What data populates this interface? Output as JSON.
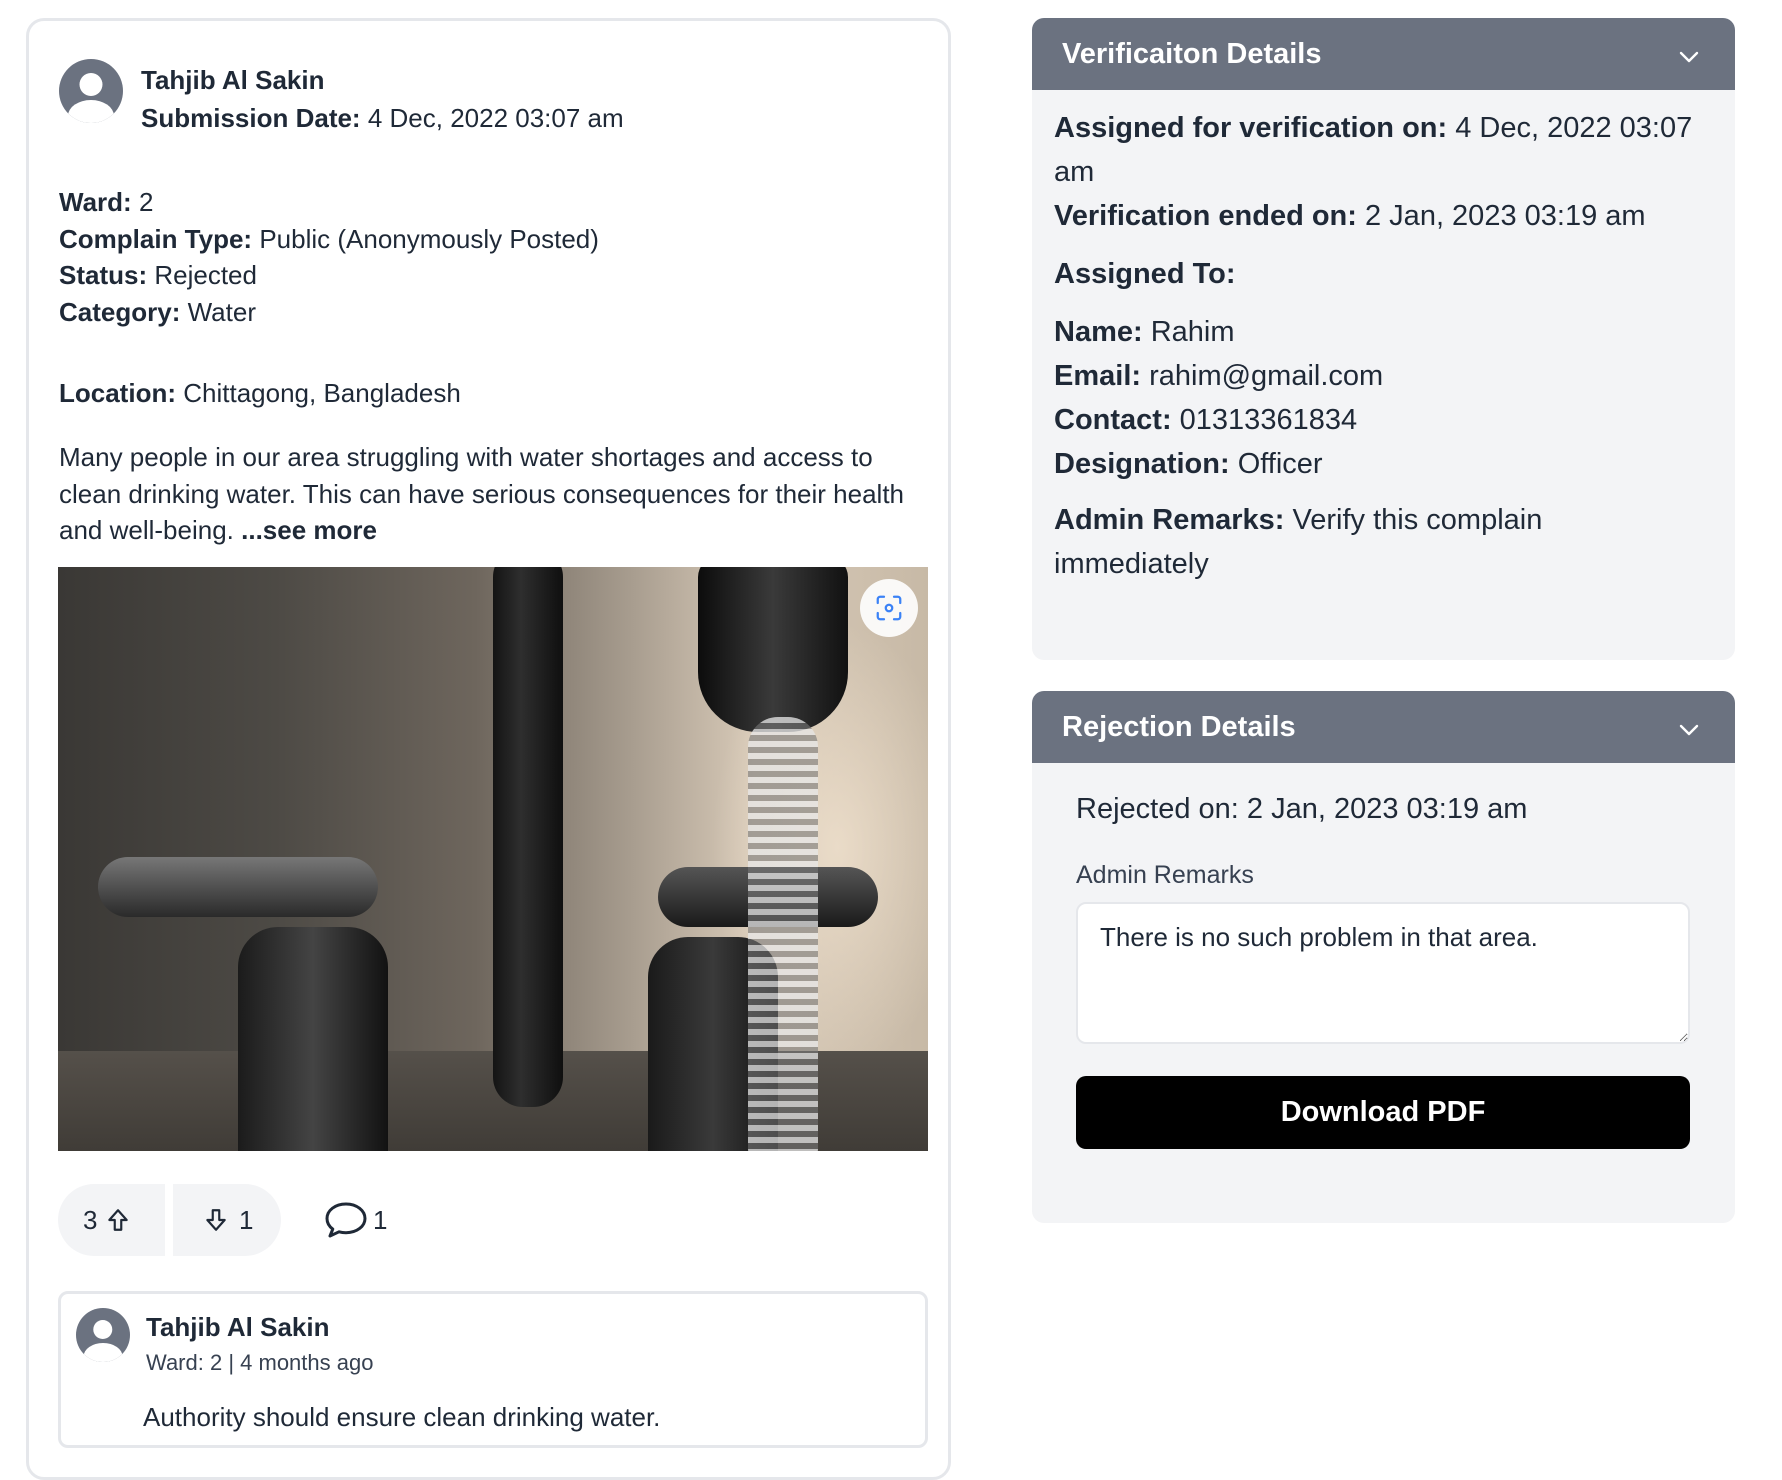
{
  "post": {
    "author_name": "Tahjib Al Sakin",
    "submission_label": "Submission Date:",
    "submission_date": "4 Dec, 2022 03:07 am",
    "ward_label": "Ward:",
    "ward": "2",
    "complain_type_label": "Complain Type:",
    "complain_type": "Public (Anonymously Posted)",
    "status_label": "Status:",
    "status": "Rejected",
    "category_label": "Category:",
    "category": "Water",
    "location_label": "Location:",
    "location": "Chittagong, Bangladesh",
    "description": "Many people in our area struggling with water shortages and access to clean drinking water. This can have serious consequences for their health and well-being.",
    "see_more": "...see more",
    "image_icon": "focus-scan-icon",
    "upvotes": "3",
    "downvotes": "1",
    "comments": "1"
  },
  "comment": {
    "author_name": "Tahjib Al Sakin",
    "meta": "Ward: 2 | 4 months ago",
    "text": "Authority should ensure clean drinking water."
  },
  "verification": {
    "title": "Verificaiton Details",
    "assigned_on_label": "Assigned for verification on:",
    "assigned_on": "4 Dec, 2022 03:07 am",
    "ended_on_label": "Verification ended on:",
    "ended_on": "2 Jan, 2023 03:19 am",
    "assigned_to_label": "Assigned To:",
    "name_label": "Name:",
    "name": "Rahim",
    "email_label": "Email:",
    "email": "rahim@gmail.com",
    "contact_label": "Contact:",
    "contact": "01313361834",
    "designation_label": "Designation:",
    "designation": "Officer",
    "admin_remarks_label": "Admin Remarks:",
    "admin_remarks": "Verify this complain immediately"
  },
  "rejection": {
    "title": "Rejection Details",
    "rejected_on": "Rejected on: 2 Jan, 2023 03:19 am",
    "admin_remarks_label": "Admin Remarks",
    "admin_remarks": "There is no such problem in that area.",
    "download_label": "Download PDF"
  },
  "colors": {
    "panel_header": "#6b7280",
    "panel_bg": "#f3f4f6",
    "button_bg": "#000000",
    "icon_accent": "#3b82f6"
  }
}
